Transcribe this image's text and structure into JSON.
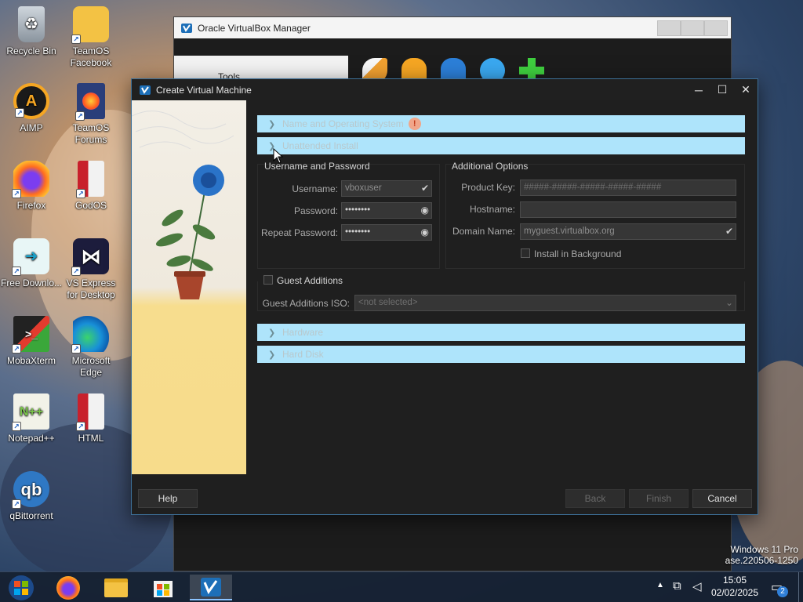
{
  "desktop": {
    "icons": [
      {
        "label": "Recycle Bin",
        "icon": "recycle-bin-icon"
      },
      {
        "label": "TeamOS Facebook",
        "icon": "folder-shortcut-icon"
      },
      {
        "label": "AIMP",
        "icon": "aimp-icon"
      },
      {
        "label": "TeamOS Forums",
        "icon": "firefox-doc-icon"
      },
      {
        "label": "Firefox",
        "icon": "firefox-icon"
      },
      {
        "label": "GodOS",
        "icon": "document-icon"
      },
      {
        "label": "Free Downlo...",
        "icon": "free-download-icon"
      },
      {
        "label": "VS Express for Desktop",
        "icon": "visual-studio-icon"
      },
      {
        "label": "MobaXterm",
        "icon": "mobaxterm-icon"
      },
      {
        "label": "Microsoft Edge",
        "icon": "edge-icon"
      },
      {
        "label": "Notepad++",
        "icon": "notepadpp-icon"
      },
      {
        "label": "HTML",
        "icon": "html-file-icon"
      },
      {
        "label": "qBittorrent",
        "icon": "qbittorrent-icon"
      }
    ]
  },
  "bg_window": {
    "title": "Oracle VirtualBox Manager",
    "tools_label": "Tools"
  },
  "dialog": {
    "title": "Create Virtual Machine",
    "sections": {
      "name_os": "Name and Operating System",
      "unattended": "Unattended Install",
      "hardware": "Hardware",
      "hard_disk": "Hard Disk"
    },
    "user_pass": {
      "title": "Username and Password",
      "username_label": "Username:",
      "username_value": "vboxuser",
      "password_label": "Password:",
      "password_value": "••••••••",
      "repeat_label": "Repeat Password:",
      "repeat_value": "••••••••"
    },
    "additional": {
      "title": "Additional Options",
      "product_key_label": "Product Key:",
      "product_key_value": "#####-#####-#####-#####-#####",
      "hostname_label": "Hostname:",
      "hostname_value": "",
      "domain_label": "Domain Name:",
      "domain_value": "myguest.virtualbox.org",
      "install_bg_label": "Install in Background"
    },
    "guest": {
      "label": "Guest Additions",
      "iso_label": "Guest Additions ISO:",
      "iso_value": "<not selected>"
    },
    "buttons": {
      "help": "Help",
      "back": "Back",
      "finish": "Finish",
      "cancel": "Cancel"
    }
  },
  "taskbar": {
    "clock_time": "15:05",
    "clock_date": "02/02/2025",
    "notification_count": "2"
  },
  "watermark": {
    "line1": "Windows 11 Pro",
    "line2": "ase.220506-1250"
  },
  "colors": {
    "section_bar": "#aee4fb",
    "dialog_bg": "#1f1f1f",
    "accent": "#3d6f97"
  }
}
